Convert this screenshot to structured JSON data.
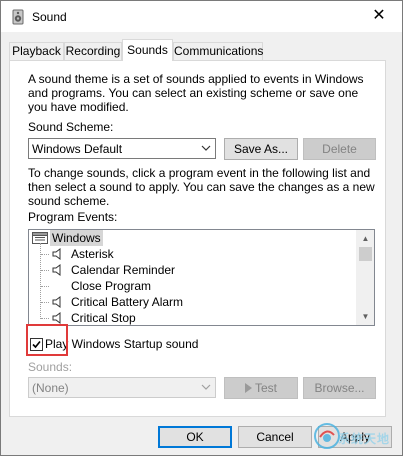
{
  "window": {
    "title": "Sound",
    "close_glyph": "✕",
    "icon": "speaker-icon"
  },
  "tabs": [
    {
      "label": "Playback"
    },
    {
      "label": "Recording"
    },
    {
      "label": "Sounds"
    },
    {
      "label": "Communications"
    }
  ],
  "active_tab": "Sounds",
  "sounds": {
    "description": "A sound theme is a set of sounds applied to events in Windows and programs.  You can select an existing scheme or save one you have modified.",
    "scheme_label": "Sound Scheme:",
    "scheme_value": "Windows Default",
    "save_as_label": "Save As...",
    "delete_label": "Delete",
    "instructions": "To change sounds, click a program event in the following list and then select a sound to apply.  You can save the changes as a new sound scheme.",
    "events_label": "Program Events:",
    "events": {
      "group": "Windows",
      "items": [
        {
          "label": "Asterisk",
          "has_sound": true
        },
        {
          "label": "Calendar Reminder",
          "has_sound": true
        },
        {
          "label": "Close Program",
          "has_sound": false
        },
        {
          "label": "Critical Battery Alarm",
          "has_sound": true
        },
        {
          "label": "Critical Stop",
          "has_sound": true
        }
      ]
    },
    "startup_checkbox_label": "Play Windows Startup sound",
    "startup_checked": true,
    "sounds_label": "Sounds:",
    "sound_value": "(None)",
    "test_label": "Test",
    "browse_label": "Browse..."
  },
  "footer": {
    "ok_label": "OK",
    "cancel_label": "Cancel",
    "apply_label": "Apply"
  },
  "watermark": {
    "text": "系统天地"
  },
  "colors": {
    "highlight_box": "#e03a3a",
    "default_button_border": "#0078d7",
    "disabled_text": "#838383"
  }
}
